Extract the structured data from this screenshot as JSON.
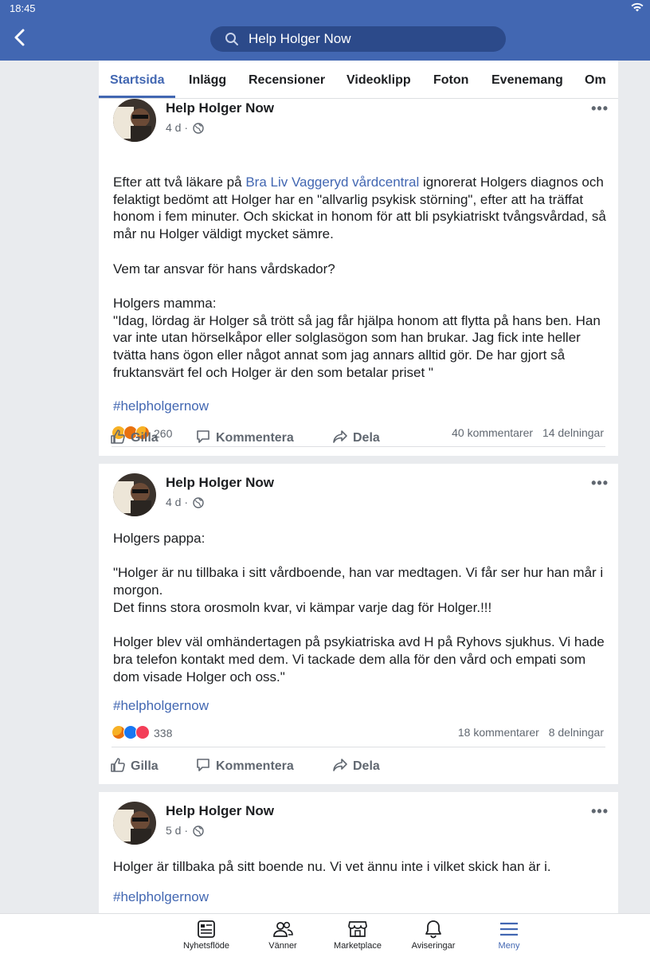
{
  "status": {
    "time": "18:45",
    "wifi_icon": "wifi-icon"
  },
  "header": {
    "search_text": "Help Holger Now",
    "back_icon": "back-arrow-icon",
    "search_icon": "search-icon"
  },
  "tabs": [
    {
      "label": "Startsida",
      "active": true
    },
    {
      "label": "Inlägg"
    },
    {
      "label": "Recensioner"
    },
    {
      "label": "Videoklipp"
    },
    {
      "label": "Foton"
    },
    {
      "label": "Evenemang"
    },
    {
      "label": "Om"
    }
  ],
  "posts": [
    {
      "author": "Help Holger Now",
      "time": "4 d",
      "sep": "·",
      "text_a": "Efter att två läkare på ",
      "text_link": "Bra Liv Vaggeryd vårdcentral",
      "text_b": "  ignorerat Holgers diagnos och felaktigt bedömt att Holger har en \"allvarlig psykisk störning\", efter att ha träffat honom i fem minuter. Och skickat in honom för att bli psykiatriskt tvångsvårdad, så mår nu Holger väldigt mycket sämre.",
      "p2": "Vem tar ansvar för hans vårdskador?",
      "p3_title": "Holgers mamma:",
      "p3_quote": "\"Idag, lördag är Holger så trött så jag får hjälpa honom att flytta på hans ben. Han var inte utan hörselkåpor eller solglasögon som han brukar. Jag fick inte heller tvätta hans ögon eller något annat som jag annars alltid gör. De har gjort så fruktansvärt fel och Holger är den som betalar priset \"",
      "hashtag": "#helpholgernow",
      "reactions": "260",
      "comments": "40 kommentarer",
      "shares": "14 delningar"
    },
    {
      "author": "Help Holger Now",
      "time": "4 d",
      "sep": "·",
      "p1": "Holgers pappa:",
      "p2a": "\"Holger är nu tillbaka i sitt vårdboende, han var medtagen. Vi får ser hur han mår i morgon.",
      "p2b": "Det finns stora orosmoln kvar, vi kämpar varje dag för Holger.!!!",
      "p3": "Holger blev väl omhändertagen på psykiatriska avd H på Ryhovs sjukhus. Vi hade bra telefon kontakt med dem. Vi tackade dem alla för den vård och empati som dom visade Holger och oss.\"",
      "hashtag": "#helpholgernow",
      "reactions": "338",
      "comments": "18 kommentarer",
      "shares": "8 delningar"
    },
    {
      "author": "Help Holger Now",
      "time": "5 d",
      "sep": "·",
      "p1": "Holger är tillbaka på sitt boende nu. Vi vet ännu inte i vilket skick han är i.",
      "hashtag": "#helpholgernow"
    }
  ],
  "actions": {
    "like": "Gilla",
    "comment": "Kommentera",
    "share": "Dela"
  },
  "bottom_nav": [
    {
      "label": "Nyhetsflöde",
      "icon": "news-feed-icon"
    },
    {
      "label": "Vänner",
      "icon": "friends-icon"
    },
    {
      "label": "Marketplace",
      "icon": "marketplace-icon"
    },
    {
      "label": "Aviseringar",
      "icon": "bell-icon"
    },
    {
      "label": "Meny",
      "icon": "menu-icon",
      "active": true
    }
  ],
  "colors": {
    "brand": "#4267b2",
    "link": "#4267b2",
    "background": "#e9ebee"
  }
}
